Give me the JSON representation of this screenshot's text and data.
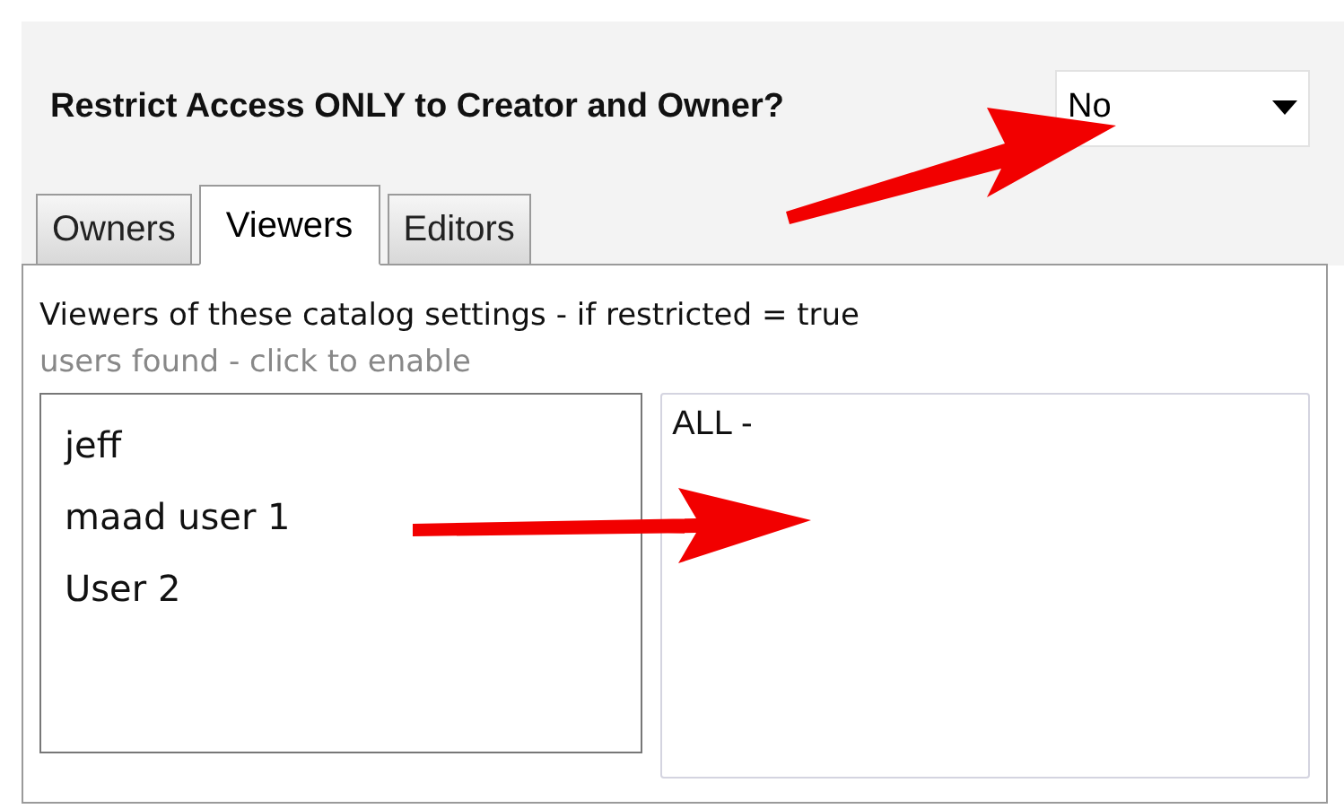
{
  "question": {
    "label": "Restrict Access ONLY to Creator and Owner?",
    "value": "No"
  },
  "tabs": [
    {
      "label": "Owners",
      "selected": false
    },
    {
      "label": "Viewers",
      "selected": true
    },
    {
      "label": "Editors",
      "selected": false
    }
  ],
  "panel": {
    "heading": "Viewers of these catalog settings - if restricted = true",
    "hint": "users found - click to enable",
    "available_users": [
      "jeff",
      "maad user 1",
      "User 2"
    ],
    "selected_users": [
      "ALL -"
    ]
  }
}
